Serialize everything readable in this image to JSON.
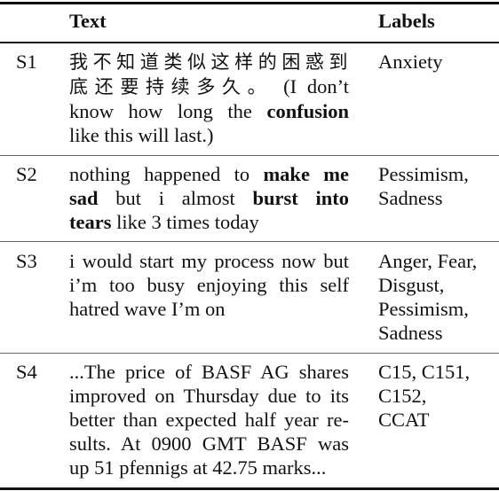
{
  "table": {
    "headers": {
      "id": "",
      "text": "Text",
      "labels": "Labels"
    },
    "rows": [
      {
        "id": "S1",
        "text_lines": [
          [
            {
              "t": "我不知道类似这样的困惑到",
              "cjk": true
            }
          ],
          [
            {
              "t": "底还要持续多久。",
              "cjk": true
            },
            {
              "t": " (I don’t"
            }
          ],
          [
            {
              "t": "know how long the "
            },
            {
              "t": "confusion",
              "b": true
            }
          ],
          [
            {
              "t": "like this will last.)"
            }
          ]
        ],
        "label_lines": [
          "Anxiety"
        ]
      },
      {
        "id": "S2",
        "text_lines": [
          [
            {
              "t": "nothing happened to "
            },
            {
              "t": "make me",
              "b": true
            }
          ],
          [
            {
              "t": "sad",
              "b": true
            },
            {
              "t": " but i almost "
            },
            {
              "t": "burst into",
              "b": true
            }
          ],
          [
            {
              "t": "tears",
              "b": true
            },
            {
              "t": " like 3 times today"
            }
          ]
        ],
        "label_lines": [
          "Pessimism,",
          "Sadness"
        ]
      },
      {
        "id": "S3",
        "text_lines": [
          [
            {
              "t": "i would start my process now but"
            }
          ],
          [
            {
              "t": "i’m too busy enjoying this self"
            }
          ],
          [
            {
              "t": "hatred wave I’m on"
            }
          ]
        ],
        "label_lines": [
          "Anger, Fear,",
          "Disgust,",
          "Pessimism,",
          "Sadness"
        ]
      },
      {
        "id": "S4",
        "text_lines": [
          [
            {
              "t": "...The price of BASF AG shares"
            }
          ],
          [
            {
              "t": "improved on Thursday due to its"
            }
          ],
          [
            {
              "t": "better than expected half year re-"
            }
          ],
          [
            {
              "t": "sults. At 0900 GMT BASF was"
            }
          ],
          [
            {
              "t": "up 51 pfennigs at 42.75 marks..."
            }
          ]
        ],
        "label_lines": [
          "C15,  C151,",
          "C152,",
          "CCAT"
        ]
      }
    ]
  }
}
